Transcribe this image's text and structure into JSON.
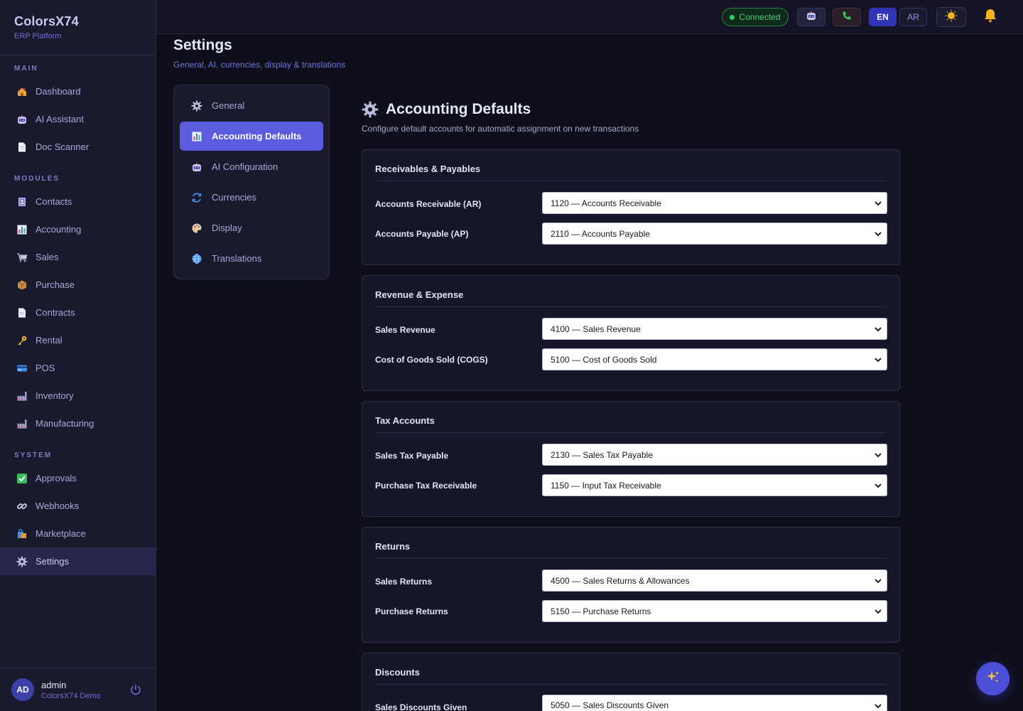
{
  "brand": {
    "name": "ColorsX74",
    "subtitle": "ERP Platform"
  },
  "sidebar": {
    "sections": [
      {
        "heading": "MAIN",
        "items": [
          {
            "label": "Dashboard",
            "icon": "house-icon"
          },
          {
            "label": "AI Assistant",
            "icon": "robot-icon"
          },
          {
            "label": "Doc Scanner",
            "icon": "document-icon"
          }
        ]
      },
      {
        "heading": "MODULES",
        "items": [
          {
            "label": "Contacts",
            "icon": "contacts-icon"
          },
          {
            "label": "Accounting",
            "icon": "bar-chart-icon"
          },
          {
            "label": "Sales",
            "icon": "cart-icon"
          },
          {
            "label": "Purchase",
            "icon": "package-icon"
          },
          {
            "label": "Contracts",
            "icon": "document-icon"
          },
          {
            "label": "Rental",
            "icon": "key-icon"
          },
          {
            "label": "POS",
            "icon": "card-icon"
          },
          {
            "label": "Inventory",
            "icon": "factory-icon"
          },
          {
            "label": "Manufacturing",
            "icon": "factory-icon"
          }
        ]
      },
      {
        "heading": "SYSTEM",
        "items": [
          {
            "label": "Approvals",
            "icon": "check-icon"
          },
          {
            "label": "Webhooks",
            "icon": "link-icon"
          },
          {
            "label": "Marketplace",
            "icon": "shopping-bag-icon"
          },
          {
            "label": "Settings",
            "icon": "gear-icon",
            "active": true
          }
        ]
      }
    ],
    "user": {
      "initials": "AD",
      "name": "admin",
      "org": "ColorsX74 Demo"
    }
  },
  "topbar": {
    "status": "Connected",
    "lang_en": "EN",
    "lang_ar": "AR",
    "active_lang": "EN"
  },
  "page": {
    "title": "Settings",
    "subtitle": "General, AI, currencies, display & translations"
  },
  "settings_menu": [
    {
      "label": "General",
      "icon": "gear-icon"
    },
    {
      "label": "Accounting Defaults",
      "icon": "bar-chart-icon",
      "active": true
    },
    {
      "label": "AI Configuration",
      "icon": "robot-icon"
    },
    {
      "label": "Currencies",
      "icon": "currency-exchange-icon"
    },
    {
      "label": "Display",
      "icon": "palette-icon"
    },
    {
      "label": "Translations",
      "icon": "globe-icon"
    }
  ],
  "content": {
    "title": "Accounting Defaults",
    "subtitle": "Configure default accounts for automatic assignment on new transactions",
    "cards": [
      {
        "title": "Receivables & Payables",
        "rows": [
          {
            "label": "Accounts Receivable (AR)",
            "value": "1120 — Accounts Receivable"
          },
          {
            "label": "Accounts Payable (AP)",
            "value": "2110 — Accounts Payable"
          }
        ]
      },
      {
        "title": "Revenue & Expense",
        "rows": [
          {
            "label": "Sales Revenue",
            "value": "4100 — Sales Revenue"
          },
          {
            "label": "Cost of Goods Sold (COGS)",
            "value": "5100 — Cost of Goods Sold"
          }
        ]
      },
      {
        "title": "Tax Accounts",
        "rows": [
          {
            "label": "Sales Tax Payable",
            "value": "2130 — Sales Tax Payable"
          },
          {
            "label": "Purchase Tax Receivable",
            "value": "1150 — Input Tax Receivable"
          }
        ]
      },
      {
        "title": "Returns",
        "rows": [
          {
            "label": "Sales Returns",
            "value": "4500 — Sales Returns & Allowances"
          },
          {
            "label": "Purchase Returns",
            "value": "5150 — Purchase Returns"
          }
        ]
      },
      {
        "title": "Discounts",
        "rows": [
          {
            "label": "Sales Discounts Given",
            "value": "5050 — Sales Discounts Given"
          }
        ]
      }
    ]
  },
  "colors": {
    "accent": "#5a5ce0",
    "background": "#0f0f1c",
    "sidebar": "#1a1a2e",
    "status_green": "#48d07a"
  }
}
